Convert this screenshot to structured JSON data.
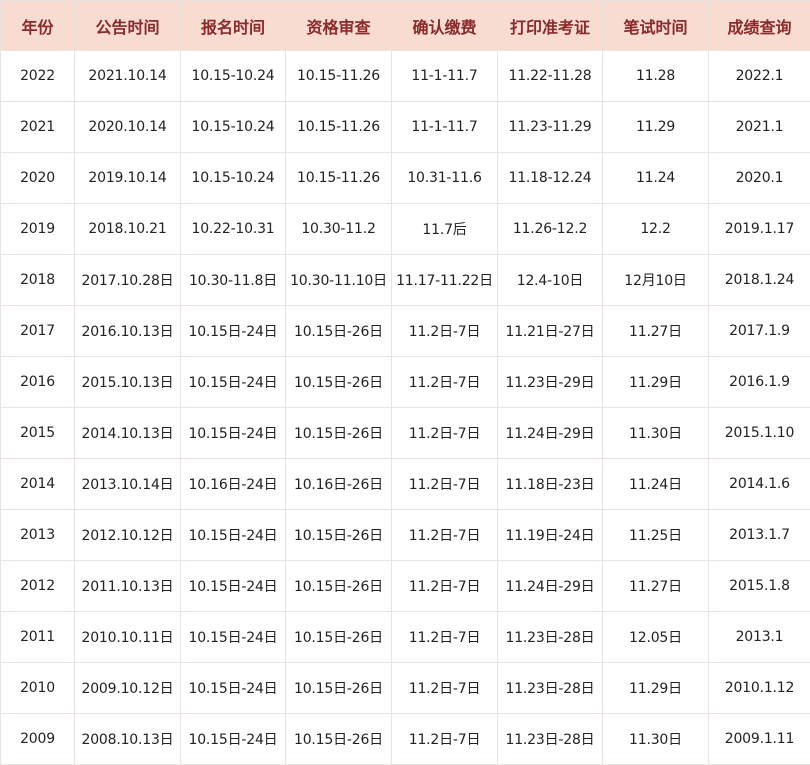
{
  "table": {
    "headers": [
      "年份",
      "公告时间",
      "报名时间",
      "资格审查",
      "确认缴费",
      "打印准考证",
      "笔试时间",
      "成绩查询"
    ],
    "rows": [
      [
        "2022",
        "2021.10.14",
        "10.15-10.24",
        "10.15-11.26",
        "11-1-11.7",
        "11.22-11.28",
        "11.28",
        "2022.1"
      ],
      [
        "2021",
        "2020.10.14",
        "10.15-10.24",
        "10.15-11.26",
        "11-1-11.7",
        "11.23-11.29",
        "11.29",
        "2021.1"
      ],
      [
        "2020",
        "2019.10.14",
        "10.15-10.24",
        "10.15-11.26",
        "10.31-11.6",
        "11.18-12.24",
        "11.24",
        "2020.1"
      ],
      [
        "2019",
        "2018.10.21",
        "10.22-10.31",
        "10.30-11.2",
        "11.7后",
        "11.26-12.2",
        "12.2",
        "2019.1.17"
      ],
      [
        "2018",
        "2017.10.28日",
        "10.30-11.8日",
        "10.30-11.10日",
        "11.17-11.22日",
        "12.4-10日",
        "12月10日",
        "2018.1.24"
      ],
      [
        "2017",
        "2016.10.13日",
        "10.15日-24日",
        "10.15日-26日",
        "11.2日-7日",
        "11.21日-27日",
        "11.27日",
        "2017.1.9"
      ],
      [
        "2016",
        "2015.10.13日",
        "10.15日-24日",
        "10.15日-26日",
        "11.2日-7日",
        "11.23日-29日",
        "11.29日",
        "2016.1.9"
      ],
      [
        "2015",
        "2014.10.13日",
        "10.15日-24日",
        "10.15日-26日",
        "11.2日-7日",
        "11.24日-29日",
        "11.30日",
        "2015.1.10"
      ],
      [
        "2014",
        "2013.10.14日",
        "10.16日-24日",
        "10.16日-26日",
        "11.2日-7日",
        "11.18日-23日",
        "11.24日",
        "2014.1.6"
      ],
      [
        "2013",
        "2012.10.12日",
        "10.15日-24日",
        "10.15日-26日",
        "11.2日-7日",
        "11.19日-24日",
        "11.25日",
        "2013.1.7"
      ],
      [
        "2012",
        "2011.10.13日",
        "10.15日-24日",
        "10.15日-26日",
        "11.2日-7日",
        "11.24日-29日",
        "11.27日",
        "2015.1.8"
      ],
      [
        "2011",
        "2010.10.11日",
        "10.15日-24日",
        "10.15日-26日",
        "11.2日-7日",
        "11.23日-28日",
        "12.05日",
        "2013.1"
      ],
      [
        "2010",
        "2009.10.12日",
        "10.15日-24日",
        "10.15日-26日",
        "11.2日-7日",
        "11.23日-28日",
        "11.29日",
        "2010.1.12"
      ],
      [
        "2009",
        "2008.10.13日",
        "10.15日-24日",
        "10.15日-26日",
        "11.2日-7日",
        "11.23日-28日",
        "11.30日",
        "2009.1.11"
      ]
    ]
  },
  "colors": {
    "header_background": "#f8dcd2",
    "header_text": "#8a2a2a",
    "cell_text": "#222222",
    "border": "#e8e2e0"
  }
}
